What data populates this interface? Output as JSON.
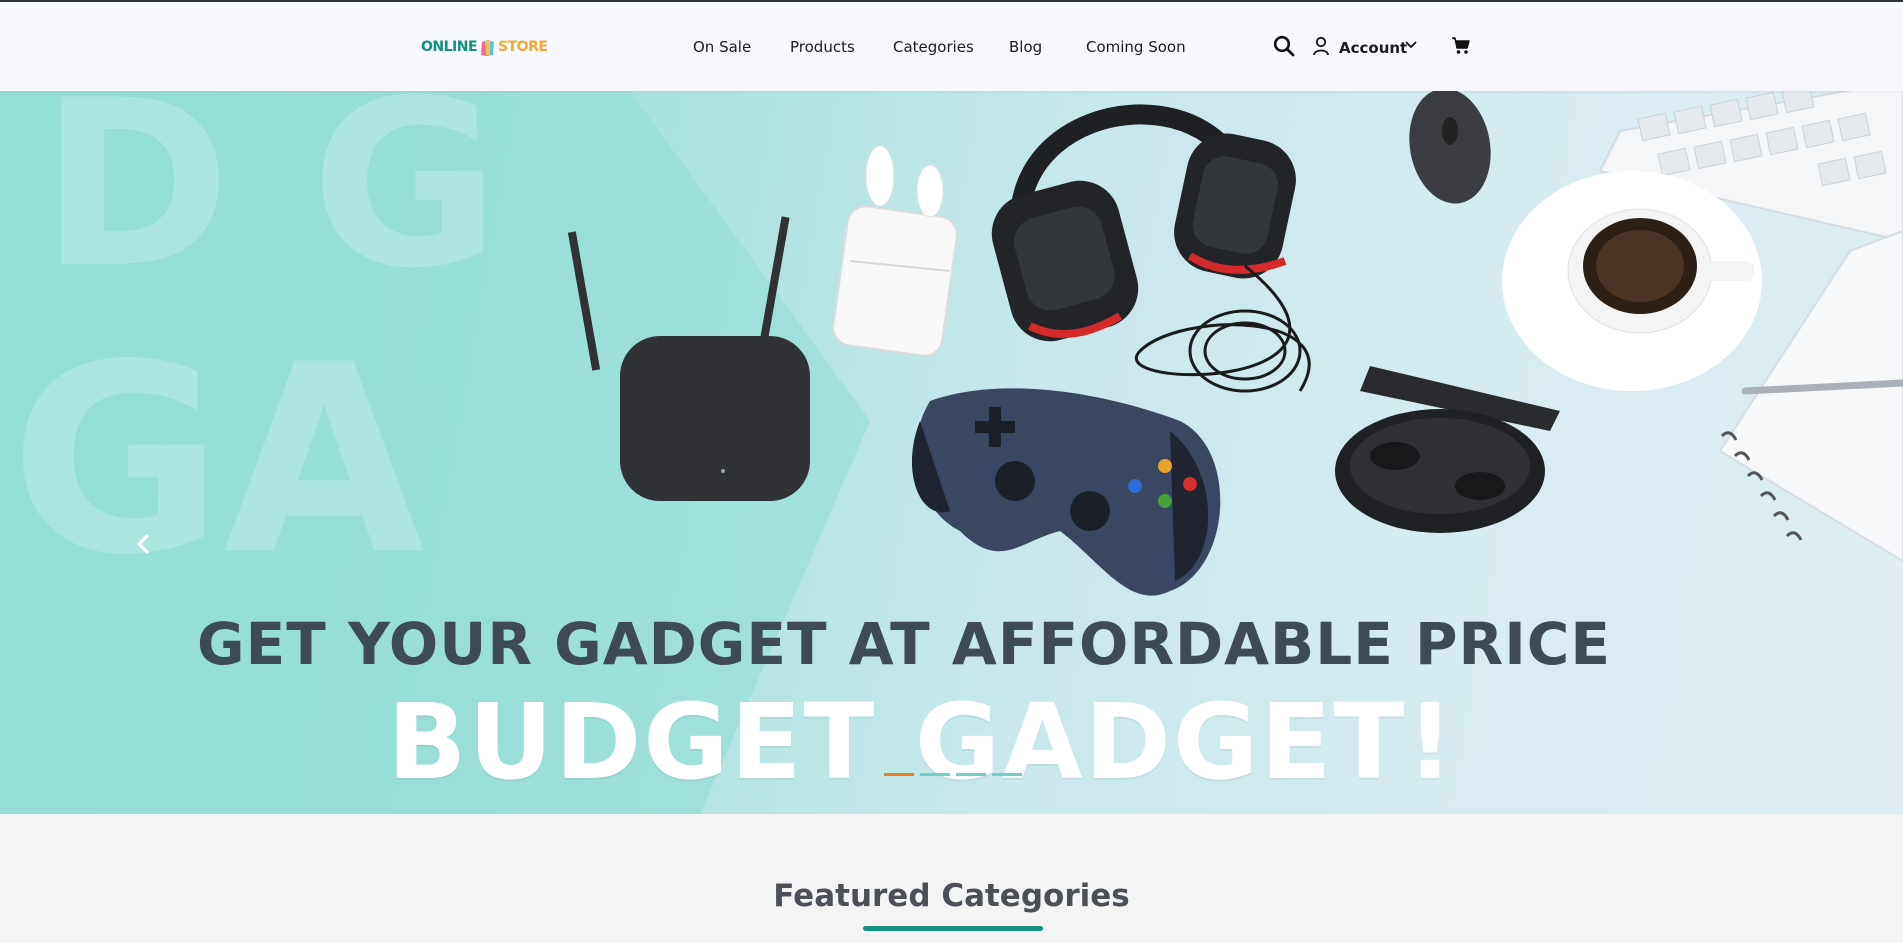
{
  "header": {
    "logo_left": "ONLINE",
    "logo_right": "STORE",
    "nav": [
      {
        "label": "On Sale"
      },
      {
        "label": "Products"
      },
      {
        "label": "Categories"
      },
      {
        "label": "Blog"
      },
      {
        "label": "Coming Soon"
      }
    ],
    "account_label": "Account",
    "icons": [
      "search-icon",
      "user-icon",
      "chevron-down-icon",
      "cart-icon"
    ]
  },
  "hero": {
    "ghost_text": "GADGET",
    "headline": "GET YOUR GADGET AT AFFORDABLE PRICE",
    "tagline": "BUDGET GADGET!",
    "slide_count": 4,
    "active_slide": 1,
    "products": [
      "wifi-extender",
      "wireless-earbuds",
      "gaming-headset",
      "wireless-mouse",
      "keyboard",
      "coffee-cup",
      "gamepad",
      "earbuds-case",
      "notebook",
      "pen"
    ]
  },
  "featured": {
    "title": "Featured Categories"
  },
  "colors": {
    "brand_teal": "#17917f",
    "brand_orange": "#f3a833",
    "indicator_active": "#e97d1f",
    "indicator_inactive": "#6fcfc4",
    "header_bg": "#f6f8fd"
  }
}
